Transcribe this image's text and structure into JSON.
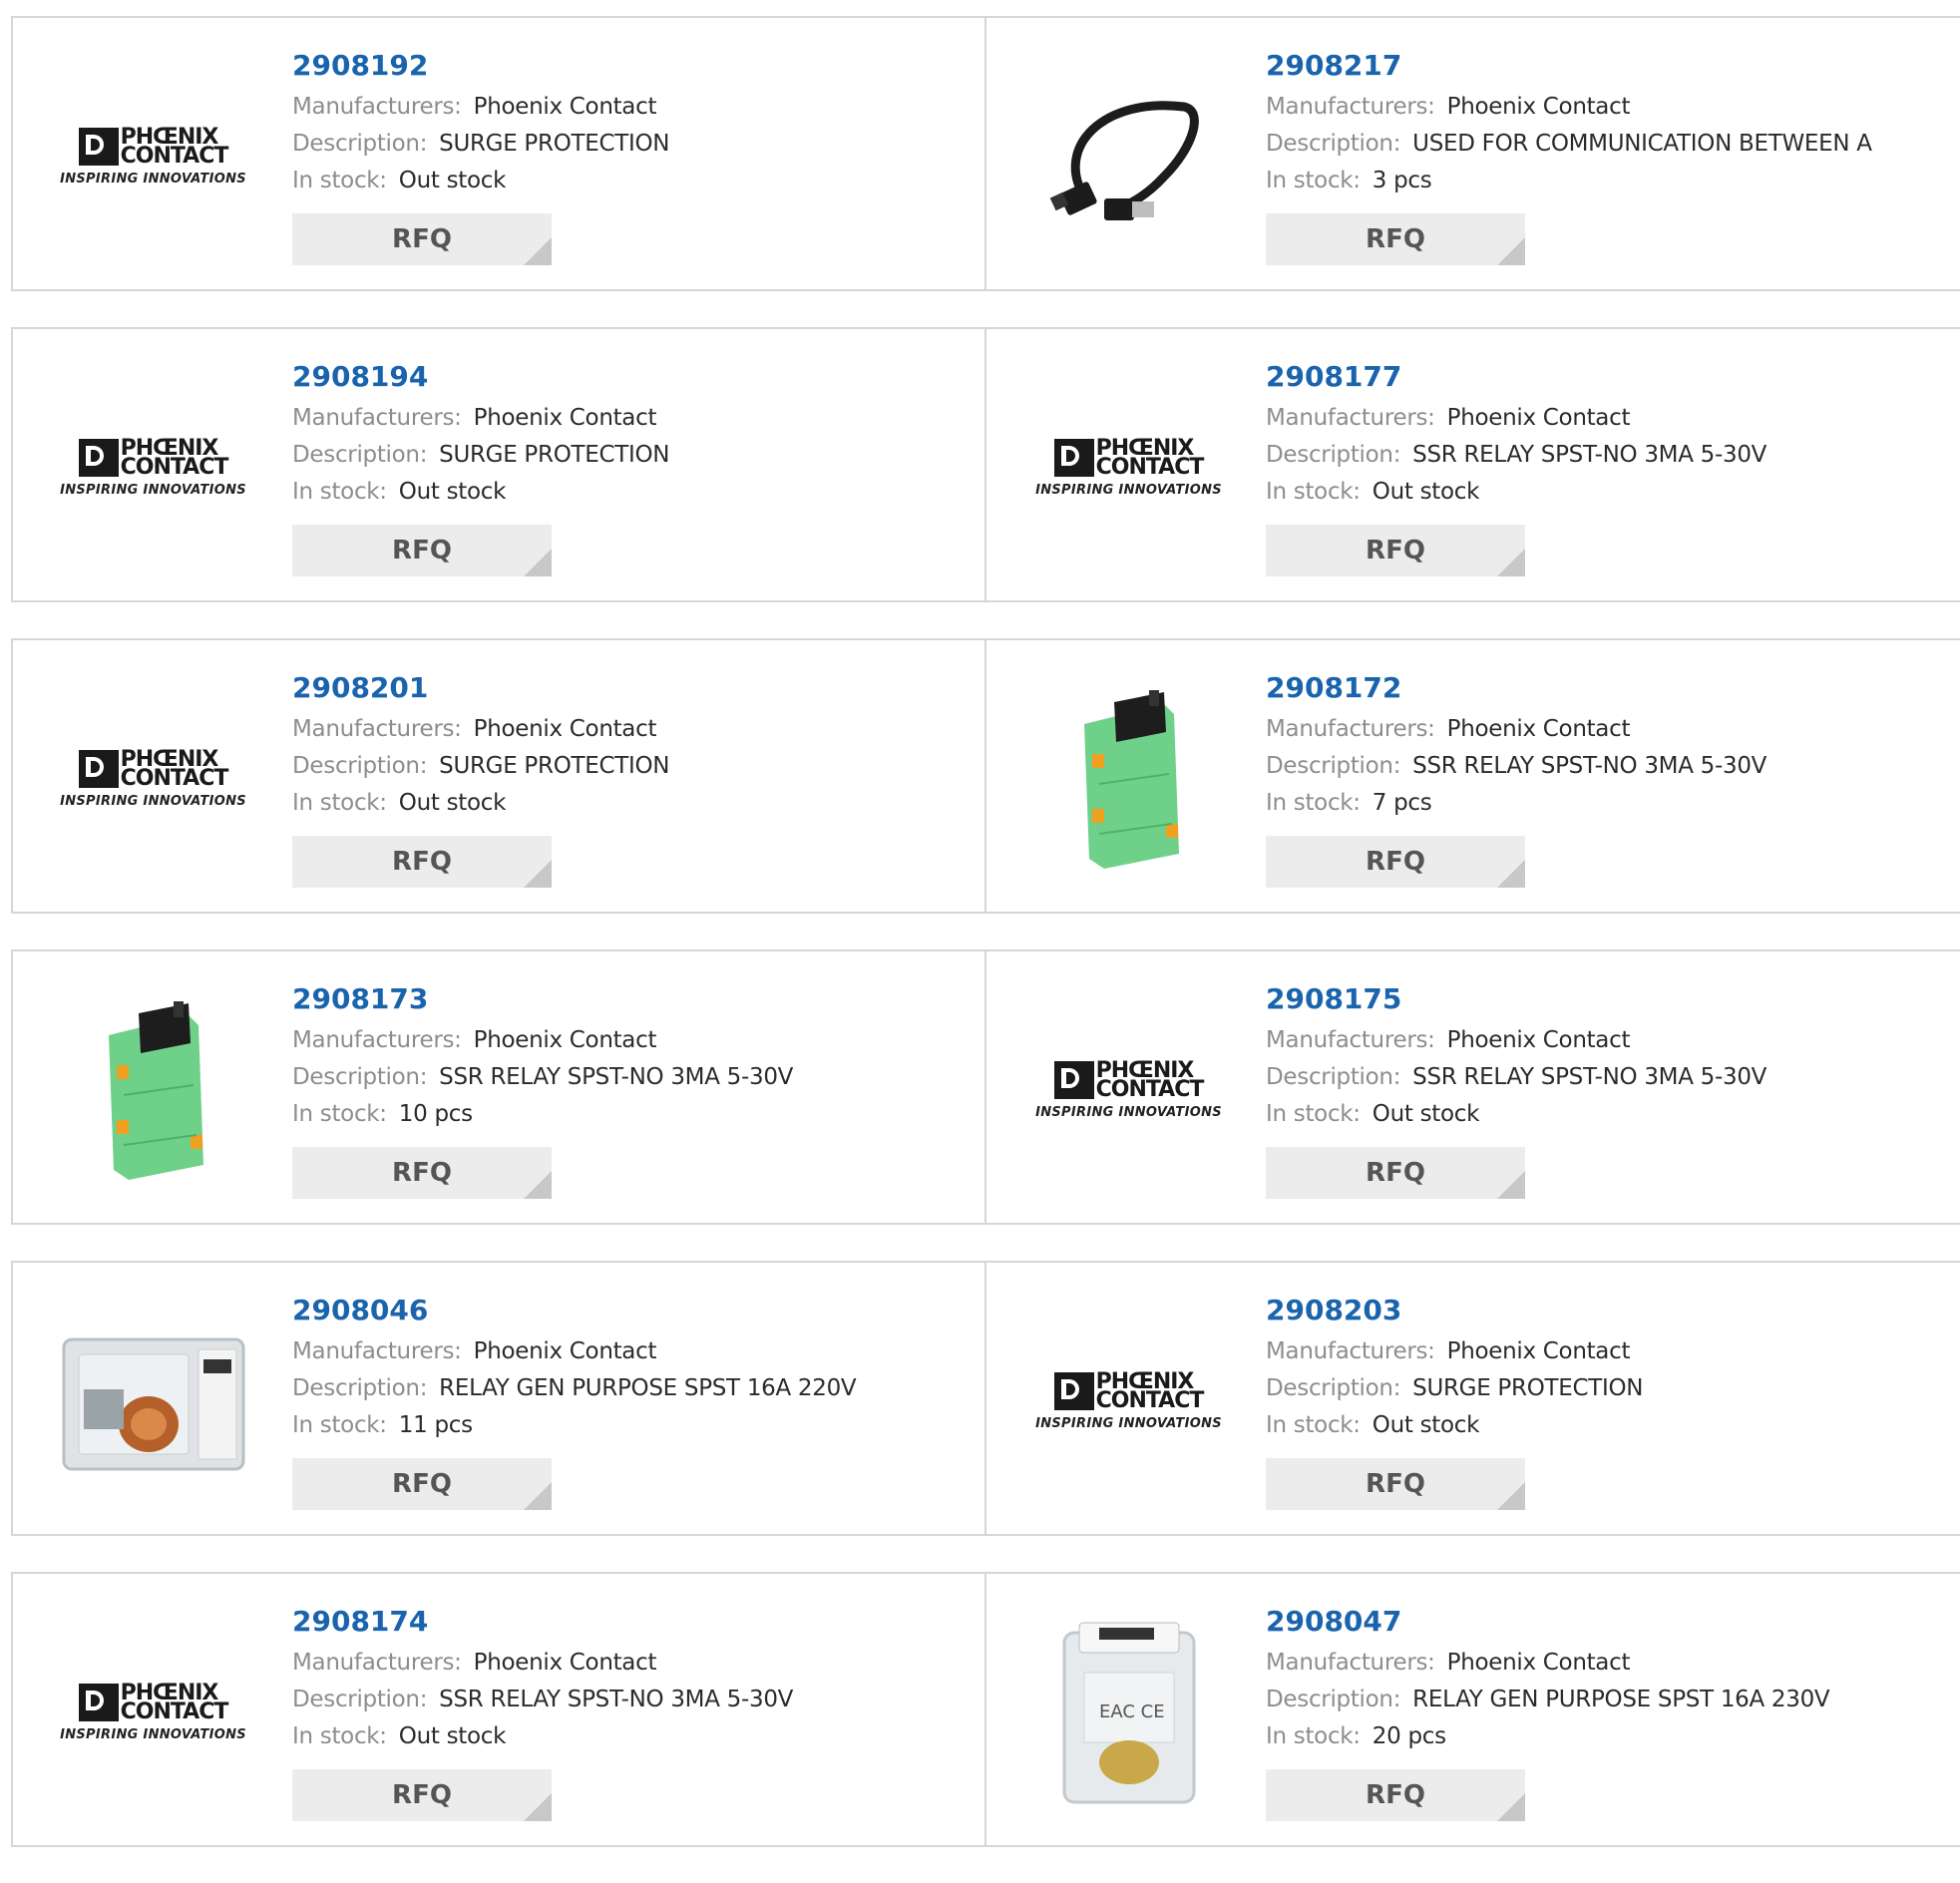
{
  "labels": {
    "manufacturer": "Manufacturers:",
    "description": "Description:",
    "stock": "In stock:",
    "rfq": "RFQ"
  },
  "logo": {
    "line1": "PHŒNIX",
    "line2": "CONTACT",
    "tagline": "INSPIRING INNOVATIONS"
  },
  "products": [
    {
      "part": "2908192",
      "manufacturer": "Phoenix Contact",
      "description": "SURGE PROTECTION",
      "stock": "Out stock",
      "image": "phoenix-logo"
    },
    {
      "part": "2908217",
      "manufacturer": "Phoenix Contact",
      "description": "USED FOR COMMUNICATION BETWEEN A",
      "stock": "3 pcs",
      "image": "usb-cable"
    },
    {
      "part": "2908194",
      "manufacturer": "Phoenix Contact",
      "description": "SURGE PROTECTION",
      "stock": "Out stock",
      "image": "phoenix-logo"
    },
    {
      "part": "2908177",
      "manufacturer": "Phoenix Contact",
      "description": "SSR RELAY SPST-NO 3MA 5-30V",
      "stock": "Out stock",
      "image": "phoenix-logo"
    },
    {
      "part": "2908201",
      "manufacturer": "Phoenix Contact",
      "description": "SURGE PROTECTION",
      "stock": "Out stock",
      "image": "phoenix-logo"
    },
    {
      "part": "2908172",
      "manufacturer": "Phoenix Contact",
      "description": "SSR RELAY SPST-NO 3MA 5-30V",
      "stock": "7 pcs",
      "image": "green-relay"
    },
    {
      "part": "2908173",
      "manufacturer": "Phoenix Contact",
      "description": "SSR RELAY SPST-NO 3MA 5-30V",
      "stock": "10 pcs",
      "image": "green-relay"
    },
    {
      "part": "2908175",
      "manufacturer": "Phoenix Contact",
      "description": "SSR RELAY SPST-NO 3MA 5-30V",
      "stock": "Out stock",
      "image": "phoenix-logo"
    },
    {
      "part": "2908046",
      "manufacturer": "Phoenix Contact",
      "description": "RELAY GEN PURPOSE SPST 16A 220V",
      "stock": "11 pcs",
      "image": "clear-relay"
    },
    {
      "part": "2908203",
      "manufacturer": "Phoenix Contact",
      "description": "SURGE PROTECTION",
      "stock": "Out stock",
      "image": "phoenix-logo"
    },
    {
      "part": "2908174",
      "manufacturer": "Phoenix Contact",
      "description": "SSR RELAY SPST-NO 3MA 5-30V",
      "stock": "Out stock",
      "image": "phoenix-logo"
    },
    {
      "part": "2908047",
      "manufacturer": "Phoenix Contact",
      "description": "RELAY GEN PURPOSE SPST 16A 230V",
      "stock": "20 pcs",
      "image": "cube-relay"
    }
  ],
  "colors": {
    "part_link": "#1a64ad",
    "label": "#8d8d8d",
    "value": "#2b2b2b",
    "rfq_bg": "#ececec",
    "border": "#d6d6d6"
  }
}
